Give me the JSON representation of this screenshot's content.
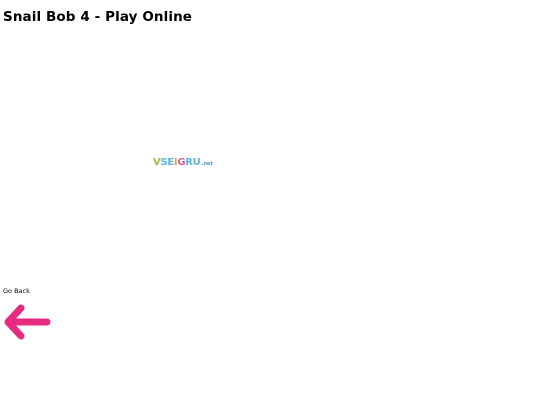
{
  "page": {
    "title": "Snail Bob 4 - Play Online"
  },
  "game": {
    "logo": {
      "main": "VSEIGRU",
      "tld": ".net",
      "colors": [
        "#9cc13a",
        "#56b7e0",
        "#e8a83a",
        "#d05ba6",
        "#56b7e0"
      ]
    }
  },
  "nav": {
    "go_back_label": "Go Back",
    "go_back_icon": "arrow-left-icon",
    "go_back_color": "#e52a7f"
  }
}
